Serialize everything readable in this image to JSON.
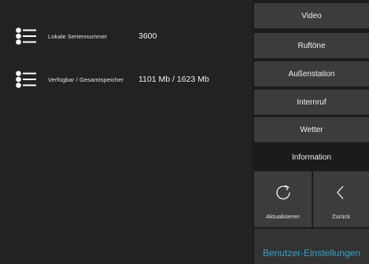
{
  "info": {
    "rows": [
      {
        "label": "Lokale Seriennummer",
        "value": "3600",
        "icon": "list-icon"
      },
      {
        "label": "Verfügbar / Gesamtspeicher",
        "value": "1101 Mb / 1623 Mb",
        "icon": "list-icon"
      }
    ]
  },
  "menu": {
    "items": [
      {
        "label": "Video"
      },
      {
        "label": "Ruftöne"
      },
      {
        "label": "Außenstation"
      },
      {
        "label": "Internruf"
      },
      {
        "label": "Wetter"
      },
      {
        "label": "Information",
        "active": true
      }
    ]
  },
  "actions": {
    "refresh": {
      "label": "Aktualisieren",
      "icon": "refresh-icon"
    },
    "back": {
      "label": "Zurück",
      "icon": "chevron-left-icon"
    }
  },
  "footer": {
    "title": "Benutzer-Einstellungen"
  },
  "colors": {
    "background": "#222222",
    "button": "#3c3c3c",
    "button_active": "#1b1b1b",
    "accent": "#34a3c9"
  }
}
